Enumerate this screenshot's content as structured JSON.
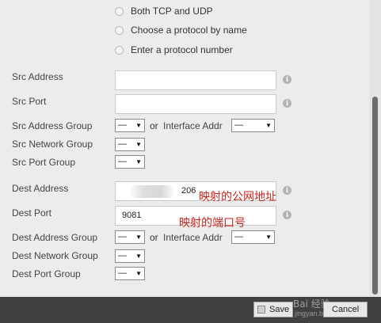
{
  "protocol": {
    "options": [
      "Both TCP and UDP",
      "Choose a protocol by name",
      "Enter a protocol number"
    ]
  },
  "src": {
    "address_label": "Src Address",
    "address_value": "",
    "port_label": "Src Port",
    "port_value": "",
    "address_group_label": "Src Address Group",
    "address_group_value": "—",
    "or_label": "or",
    "interface_addr_label": "Interface Addr",
    "interface_addr_value": "—",
    "network_group_label": "Src Network Group",
    "network_group_value": "—",
    "port_group_label": "Src Port Group",
    "port_group_value": "—"
  },
  "dest": {
    "address_label": "Dest Address",
    "address_value": "206",
    "address_annotation": "映射的公网地址",
    "port_label": "Dest Port",
    "port_value": "9081",
    "port_annotation": "映射的端口号",
    "address_group_label": "Dest Address Group",
    "address_group_value": "—",
    "or_label": "or",
    "interface_addr_label": "Interface Addr",
    "interface_addr_value": "—",
    "network_group_label": "Dest Network Group",
    "network_group_value": "—",
    "port_group_label": "Dest Port Group",
    "port_group_value": "—"
  },
  "footer": {
    "save_label": "Save",
    "cancel_label": "Cancel"
  },
  "watermark": {
    "text": "Bai 经验",
    "subtext": "jingyan.baidu.com"
  }
}
